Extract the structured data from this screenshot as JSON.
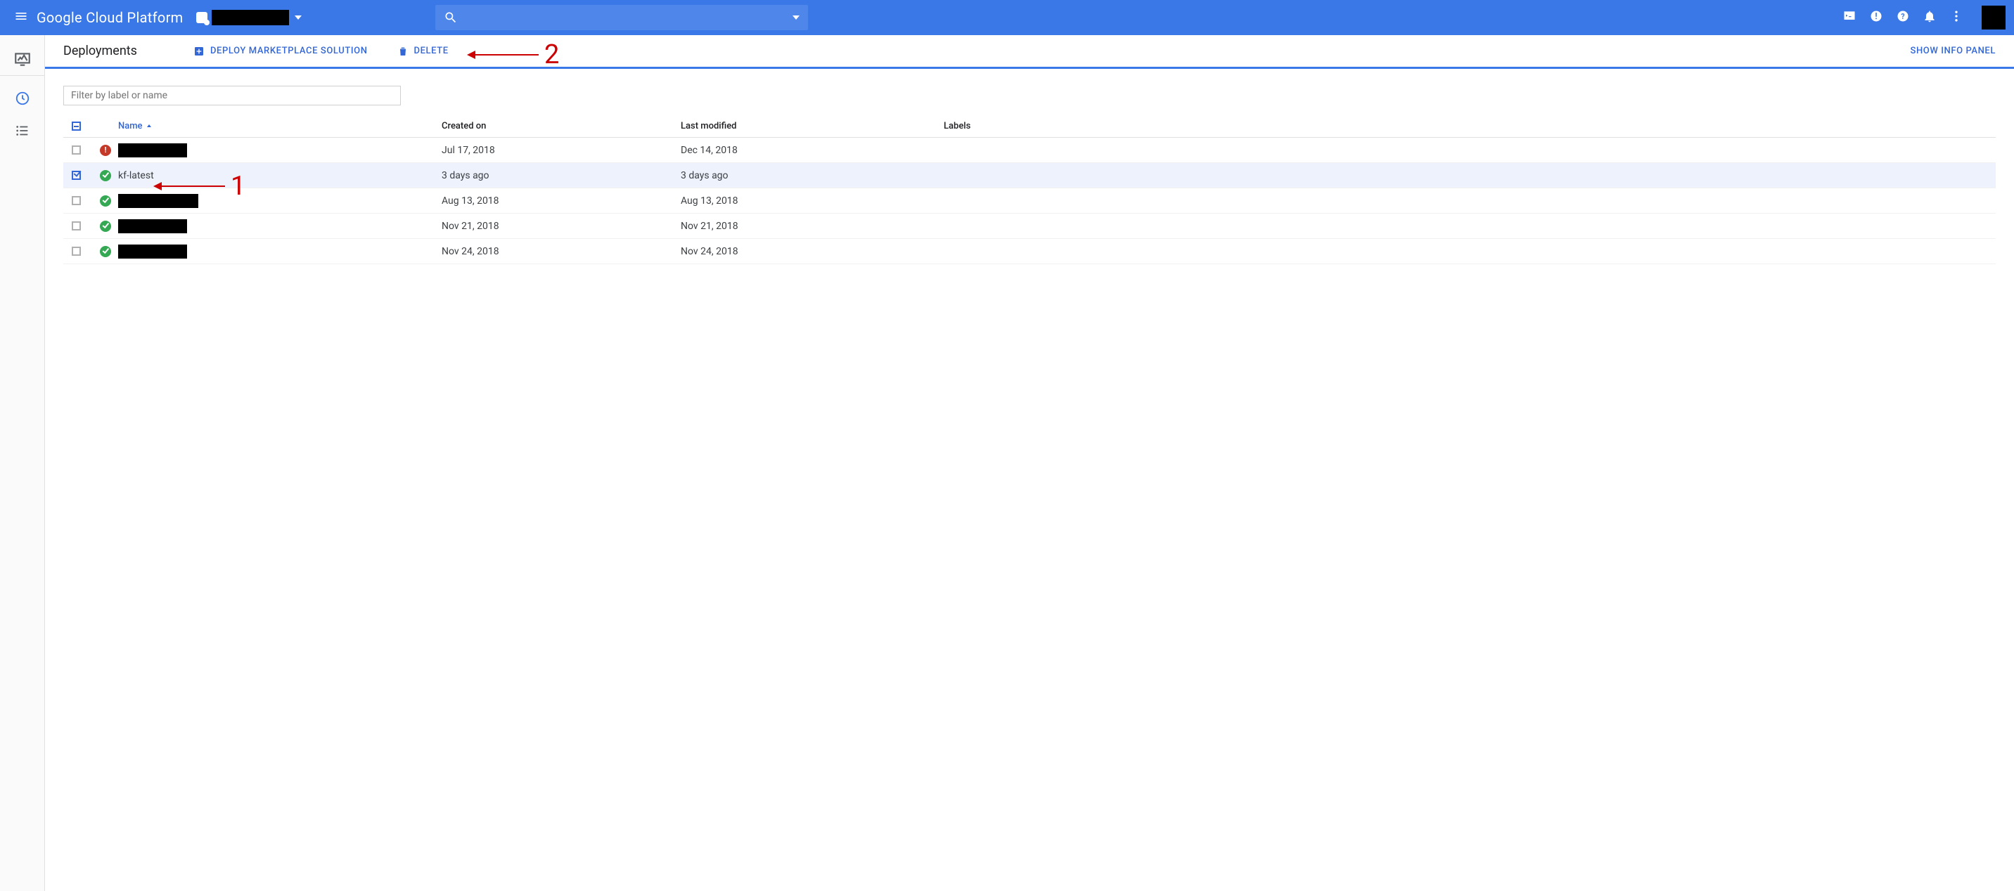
{
  "brand": "Google Cloud Platform",
  "search": {
    "placeholder": ""
  },
  "page": {
    "title": "Deployments",
    "deploy_label": "DEPLOY MARKETPLACE SOLUTION",
    "delete_label": "DELETE",
    "info_panel": "SHOW INFO PANEL"
  },
  "filter": {
    "placeholder": "Filter by label or name"
  },
  "columns": {
    "name": "Name",
    "created": "Created on",
    "modified": "Last modified",
    "labels": "Labels"
  },
  "rows": [
    {
      "checked": false,
      "status": "error",
      "name_redacted": true,
      "name": "",
      "created": "Jul 17, 2018",
      "modified": "Dec 14, 2018"
    },
    {
      "checked": true,
      "status": "ok",
      "name_redacted": false,
      "name": "kf-latest",
      "created": "3 days ago",
      "modified": "3 days ago"
    },
    {
      "checked": false,
      "status": "ok",
      "name_redacted": true,
      "name": "",
      "created": "Aug 13, 2018",
      "modified": "Aug 13, 2018"
    },
    {
      "checked": false,
      "status": "ok",
      "name_redacted": true,
      "name": "",
      "created": "Nov 21, 2018",
      "modified": "Nov 21, 2018"
    },
    {
      "checked": false,
      "status": "ok",
      "name_redacted": true,
      "name": "",
      "created": "Nov 24, 2018",
      "modified": "Nov 24, 2018"
    }
  ],
  "annotations": {
    "one": "1",
    "two": "2"
  }
}
